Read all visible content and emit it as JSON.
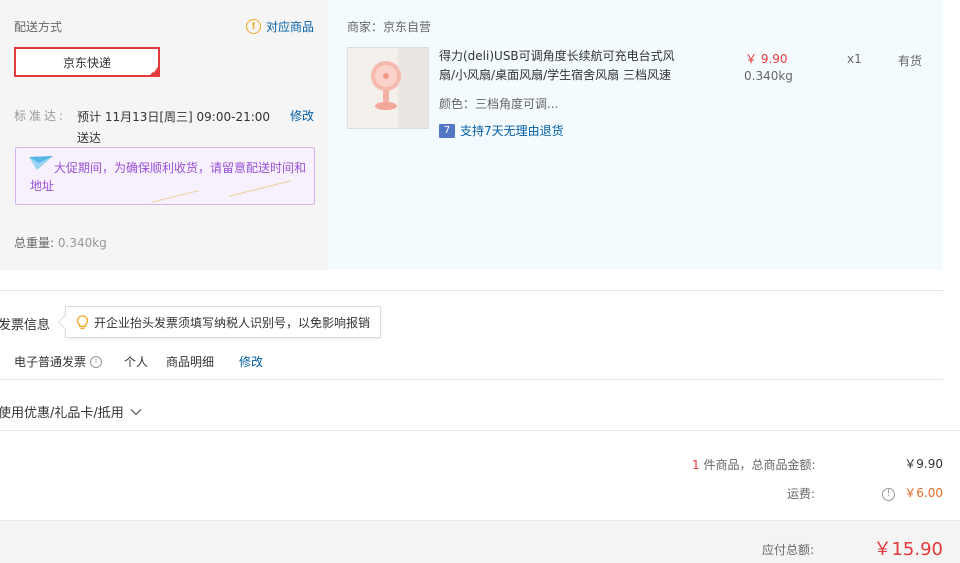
{
  "shipping": {
    "title": "配送方式",
    "match_goods": "对应商品",
    "option": "京东快递",
    "standard_label": "标准达:",
    "standard_text": "预计 11月13日[周三] 09:00-21:00 送达",
    "edit": "修改",
    "promo_notice": "大促期间，为确保顺利收货，请留意配送时间和地址",
    "weight_label": "总重量:",
    "weight_value": "0.340kg"
  },
  "goods": {
    "merchant": "商家：京东自营",
    "name": "得力(deli)USB可调角度长续航可充电台式风扇/小风扇/桌面风扇/学生宿舍风扇 三档风速",
    "price": "￥ 9.90",
    "weight": "0.340kg",
    "quantity": "x1",
    "stock": "有货",
    "color": "颜色：三档角度可调...",
    "return_policy": "支持7天无理由退货",
    "return_icon_text": "7"
  },
  "invoice": {
    "title": "发票信息",
    "tip": "开企业抬头发票须填写纳税人识别号，以免影响报销",
    "type": "电子普通发票",
    "person": "个人",
    "detail": "商品明细",
    "edit": "修改"
  },
  "coupon": {
    "label": "使用优惠/礼品卡/抵用"
  },
  "summary": {
    "count": "1",
    "goods_total_label": "件商品，总商品金额:",
    "goods_total": "￥9.90",
    "freight_label": "运费:",
    "freight": "￥6.00",
    "payable_label": "应付总额:",
    "payable": "￥15.90"
  },
  "colors": {
    "accent_red": "#e4393c",
    "link_blue": "#005ea7",
    "promo_purple": "#9a52d6",
    "freight_orange": "#e96b22"
  }
}
